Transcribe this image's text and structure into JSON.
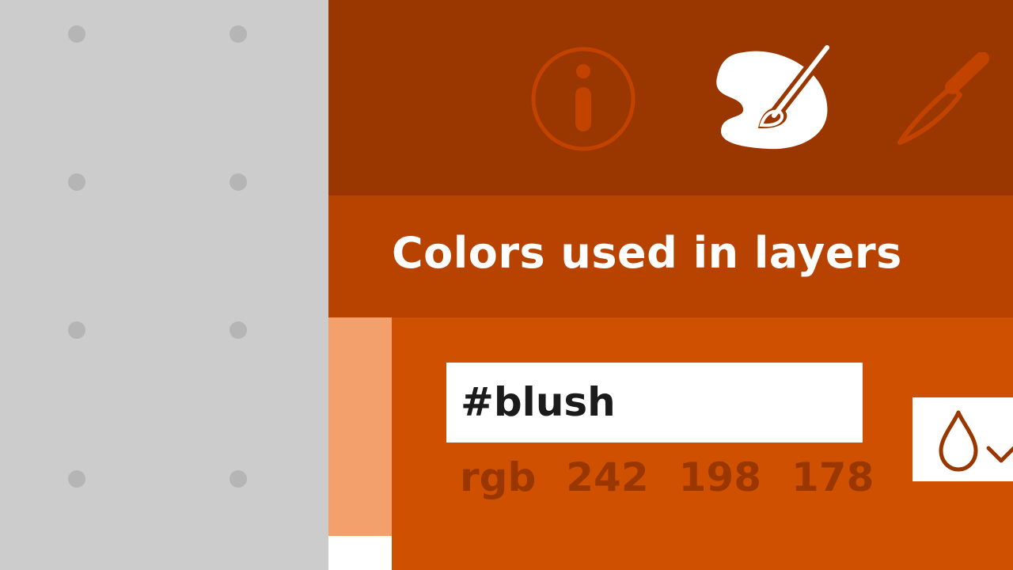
{
  "colors": {
    "canvas_bg": "#cccccc",
    "grid_dot": "#b5b5b5",
    "icon_bar_bg": "#9a3700",
    "header_bg": "#b84300",
    "panel_bg": "#cf5001",
    "accent_dark": "#9a3700",
    "swatch": "#f4a06c",
    "field_bg": "#ffffff"
  },
  "tabs": [
    {
      "icon": "info-icon",
      "state": "inactive"
    },
    {
      "icon": "palette-icon",
      "state": "active"
    },
    {
      "icon": "knife-icon",
      "state": "inactive"
    }
  ],
  "section": {
    "title": "Colors used in layers"
  },
  "color_entry": {
    "hex_name": "#blush",
    "rgb_label": "rgb",
    "r": "242",
    "g": "198",
    "b": "178"
  },
  "eyedropper": {
    "icon": "droplet-icon",
    "chevron": "chevron-down-icon"
  }
}
